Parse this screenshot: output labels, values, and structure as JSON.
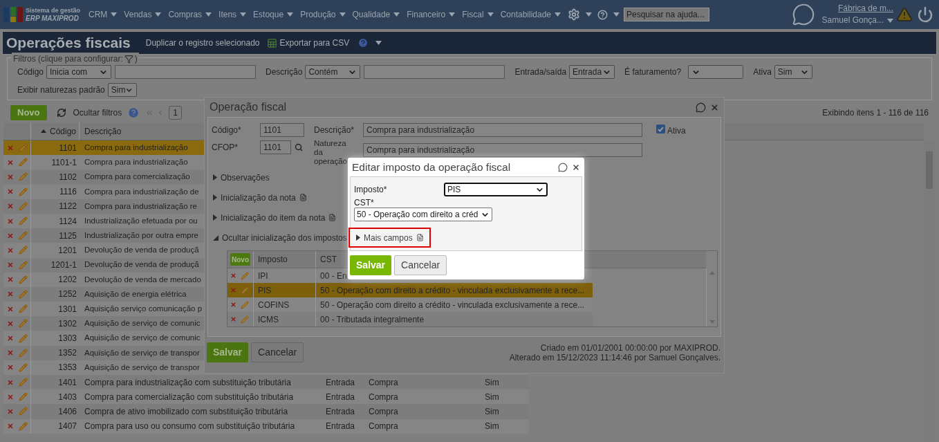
{
  "nav": {
    "logo_line1": "Sistema de gestão",
    "logo_line2": "ERP MAXIPROD",
    "menus": [
      "CRM",
      "Vendas",
      "Compras",
      "Itens",
      "Estoque",
      "Produção",
      "Qualidade",
      "Financeiro",
      "Fiscal",
      "Contabilidade"
    ],
    "search": {
      "placeholder": "Pesquisar na ajuda..."
    },
    "company": "Fábrica de m...",
    "user": "Samuel Gonça..."
  },
  "page": {
    "title": "Operações fiscais",
    "duplicate": "Duplicar o registro selecionado",
    "export": "Exportar para CSV"
  },
  "filters": {
    "legend": "Filtros (clique para configurar:",
    "legend_end": ")",
    "fields": [
      {
        "label": "Código",
        "kind": "select_text",
        "select": "Inicia com"
      },
      {
        "label": "Descrição",
        "kind": "select_text",
        "select": "Contém"
      },
      {
        "label": "Entrada/saída",
        "kind": "select",
        "select": "Entrada"
      },
      {
        "label": "É faturamento?",
        "kind": "select_empty"
      },
      {
        "label": "Ativa",
        "kind": "select",
        "select": "Sim"
      }
    ],
    "standard": {
      "label": "Exibir naturezas padrão",
      "select": "Sim"
    }
  },
  "toolbar": {
    "new": "Novo",
    "hide_filters": "Ocultar filtros",
    "page": "1",
    "summary": "Exibindo itens 1 - 116 de 116"
  },
  "table": {
    "columns": [
      "Código",
      "Descrição"
    ],
    "rows": [
      {
        "code": "1101",
        "description": "Compra para industrialização",
        "selected": true
      },
      {
        "code": "1101-1",
        "description": "Compra para industrialização",
        "selected": false
      },
      {
        "code": "1102",
        "description": "Compra para comercialização",
        "selected": false
      },
      {
        "code": "1116",
        "description": "Compra para industrialização de",
        "selected": false
      },
      {
        "code": "1122",
        "description": "Compra para industrialização re",
        "selected": false
      },
      {
        "code": "1124",
        "description": "Industrialização efetuada por ou",
        "selected": false
      },
      {
        "code": "1125",
        "description": "Industrialização por outra empre",
        "selected": false
      },
      {
        "code": "1201",
        "description": "Devolução de venda de produçã",
        "selected": false
      },
      {
        "code": "1201-1",
        "description": "Devolução de venda de produçã",
        "selected": false
      },
      {
        "code": "1202",
        "description": "Devolução de venda de mercado",
        "selected": false
      },
      {
        "code": "1252",
        "description": "Aquisição de energia elétrica",
        "selected": false
      },
      {
        "code": "1301",
        "description": "Aquisição serviço comunicação p",
        "selected": false
      },
      {
        "code": "1302",
        "description": "Aquisição de serviço de comunic",
        "selected": false
      },
      {
        "code": "1303",
        "description": "Aquisição de serviço de comunic",
        "selected": false
      },
      {
        "code": "1352",
        "description": "Aquisição de serviço de transpor",
        "selected": false
      },
      {
        "code": "1353",
        "description": "Aquisição de serviço de transpor",
        "selected": false
      },
      {
        "code": "1401",
        "description": "Compra para industrialização com substituição tributária",
        "selected": false,
        "direction": "Entrada",
        "nature": "Compra",
        "active": "Sim"
      },
      {
        "code": "1403",
        "description": "Compra para comercialização com substituição tributária",
        "selected": false,
        "direction": "Entrada",
        "nature": "Compra",
        "active": "Sim"
      },
      {
        "code": "1406",
        "description": "Compra de ativo imobilizado com substituição tributária",
        "selected": false,
        "direction": "Entrada",
        "nature": "Compra",
        "active": "Sim"
      },
      {
        "code": "1407",
        "description": "Compra para uso ou consumo com substituição tributária",
        "selected": false,
        "direction": "Entrada",
        "nature": "Compra",
        "active": "Sim"
      }
    ]
  },
  "dialog": {
    "title": "Operação fiscal",
    "code_label": "Código*",
    "code": "1101",
    "cfop_label": "CFOP*",
    "cfop": "1101",
    "description_label": "Descrição*",
    "description": "Compra para industrialização",
    "nature_label": "Natureza da operação",
    "nature": "Compra para industrialização",
    "active": {
      "label": "Ativa",
      "checked": true
    },
    "sections": [
      {
        "label": "Observações",
        "expanded": false,
        "note": false
      },
      {
        "label": "Inicialização da nota",
        "expanded": false,
        "note": true
      },
      {
        "label": "Inicialização do item da nota",
        "expanded": false,
        "note": true
      },
      {
        "label": "Ocultar inicialização dos impostos",
        "expanded": true,
        "note": false
      }
    ],
    "taxes": {
      "new": "Novo",
      "columns": [
        "Imposto",
        "CST"
      ],
      "rows": [
        {
          "tax": "IPI",
          "cst": "00 - En",
          "selected": false
        },
        {
          "tax": "PIS",
          "cst": "50 - Operação com direito a crédito - vinculada exclusivamente a rece...",
          "selected": true
        },
        {
          "tax": "COFINS",
          "cst": "50 - Operação com direito a crédito - vinculada exclusivamente a rece...",
          "selected": false
        },
        {
          "tax": "ICMS",
          "cst": "00 - Tributada integralmente",
          "selected": false
        }
      ]
    },
    "save": "Salvar",
    "cancel": "Cancelar",
    "created": "Criado em 01/01/2001 00:00:00 por MAXIPROD.",
    "changed": "Alterado em 15/12/2023 11:14:46 por Samuel Gonçalves."
  },
  "subdialog": {
    "title": "Editar imposto da operação fiscal",
    "tax_label": "Imposto*",
    "tax": "PIS",
    "cst_label": "CST*",
    "cst": "50 - Operação com direito a créd",
    "more": "Mais campos",
    "save": "Salvar",
    "cancel": "Cancelar"
  }
}
